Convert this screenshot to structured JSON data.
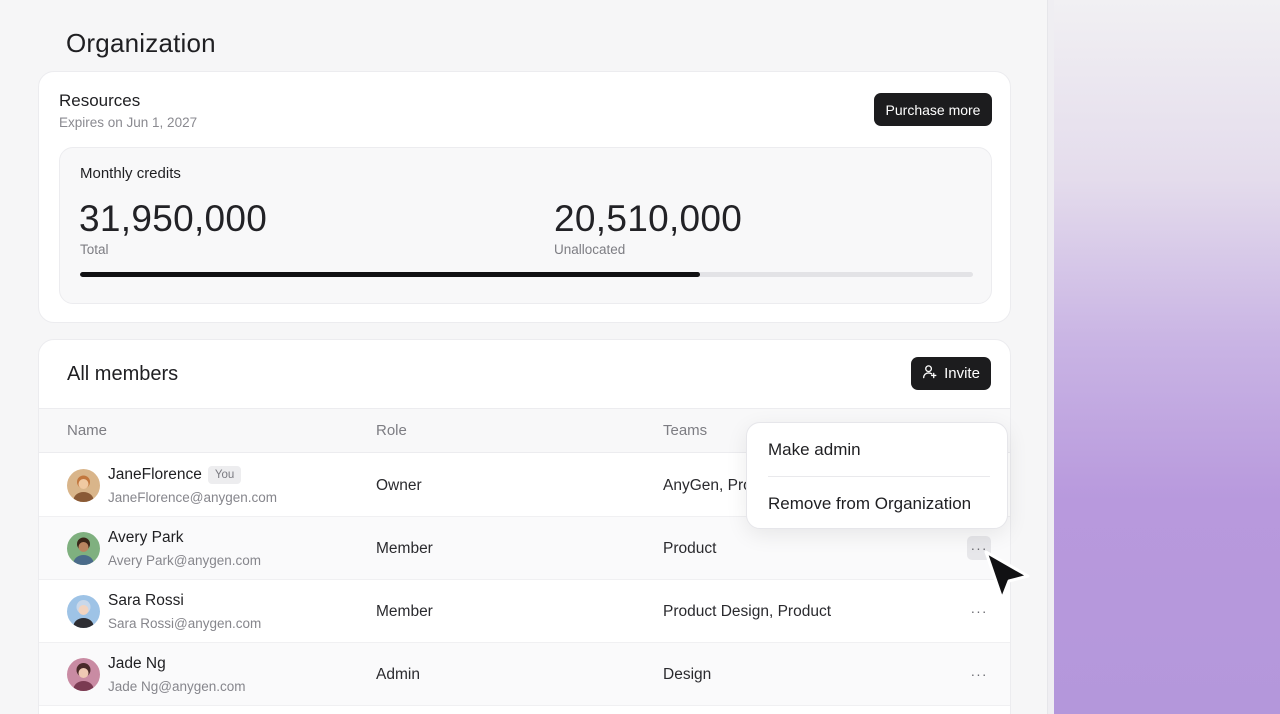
{
  "page": {
    "title": "Organization"
  },
  "resources": {
    "title": "Resources",
    "expires": "Expires on Jun 1, 2027",
    "purchase_label": "Purchase more",
    "credits": {
      "label": "Monthly credits",
      "total_value": "31,950,000",
      "total_label": "Total",
      "unallocated_value": "20,510,000",
      "unallocated_label": "Unallocated",
      "usage_fraction": 0.694
    }
  },
  "members": {
    "title": "All members",
    "invite_label": "Invite",
    "columns": {
      "name": "Name",
      "role": "Role",
      "teams": "Teams"
    },
    "rows": [
      {
        "name": "JaneFlorence",
        "badge": "You",
        "email": "JaneFlorence@anygen.com",
        "role": "Owner",
        "teams": "AnyGen, Product",
        "avatar_color": "#b07a4e"
      },
      {
        "name": "Avery Park",
        "email": "Avery Park@anygen.com",
        "role": "Member",
        "teams": "Product",
        "avatar_color": "#5a8f5c"
      },
      {
        "name": "Sara Rossi",
        "email": "Sara Rossi@anygen.com",
        "role": "Member",
        "teams": "Product Design, Product",
        "avatar_color": "#7fa8cf"
      },
      {
        "name": "Jade Ng",
        "email": "Jade Ng@anygen.com",
        "role": "Admin",
        "teams": "Design",
        "avatar_color": "#a5607a"
      }
    ]
  },
  "context_menu": {
    "items": [
      "Make admin",
      "Remove from Organization"
    ]
  },
  "icons": {
    "invite": "user-plus-icon",
    "more": "more-horizontal-icon",
    "cursor": "pointer-cursor-icon"
  }
}
